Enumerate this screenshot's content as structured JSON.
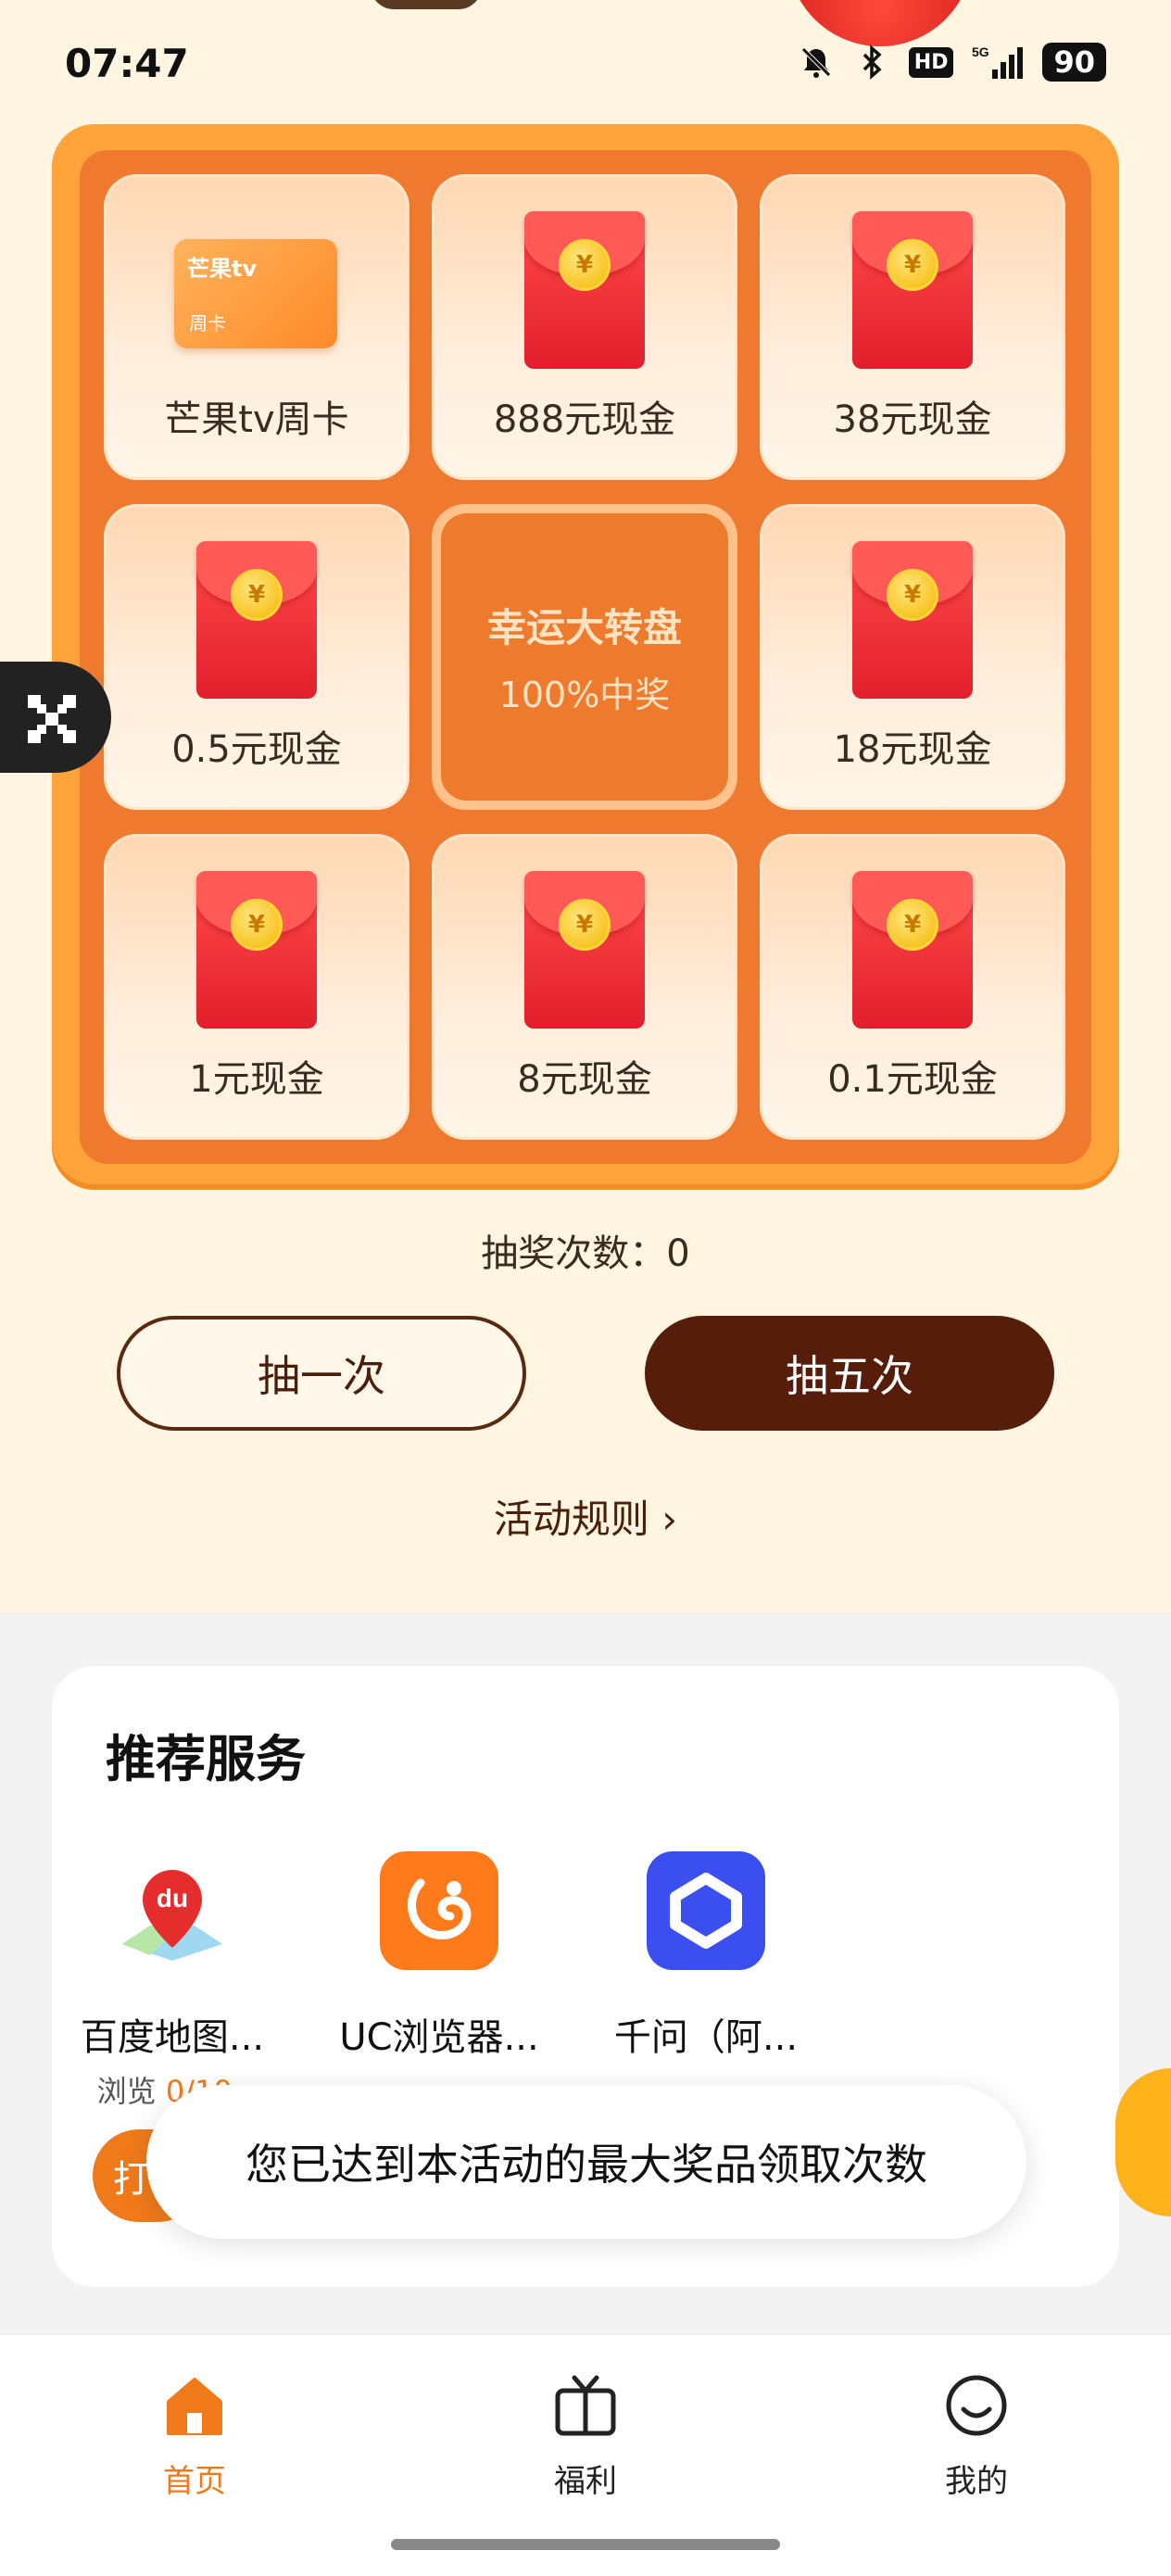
{
  "status_bar": {
    "time": "07:47",
    "hd": "HD",
    "network": "5G",
    "battery": "90"
  },
  "board": {
    "center": {
      "title": "幸运大转盘",
      "subtitle": "100%中奖"
    },
    "prizes": [
      {
        "label": "芒果tv周卡",
        "icon": "mango-tv-card"
      },
      {
        "label": "888元现金",
        "icon": "red-envelope"
      },
      {
        "label": "38元现金",
        "icon": "red-envelope"
      },
      {
        "label": "0.5元现金",
        "icon": "red-envelope"
      },
      {
        "label": "18元现金",
        "icon": "red-envelope"
      },
      {
        "label": "1元现金",
        "icon": "red-envelope"
      },
      {
        "label": "8元现金",
        "icon": "red-envelope"
      },
      {
        "label": "0.1元现金",
        "icon": "red-envelope"
      }
    ],
    "mango_card": {
      "logo": "芒果tv",
      "sub": "周卡"
    },
    "coin_symbol": "¥"
  },
  "draw": {
    "count_label": "抽奖次数：0",
    "once_label": "抽一次",
    "five_label": "抽五次",
    "rules_label": "活动规则 ›"
  },
  "services": {
    "title": "推荐服务",
    "apps": [
      {
        "name": "百度地图...",
        "progress_label": "浏览",
        "progress_value": "0/10s",
        "icon": "baidu-map-icon"
      },
      {
        "name": "UC浏览器...",
        "icon": "uc-browser-icon"
      },
      {
        "name": "千问（阿...",
        "icon": "qianwen-icon"
      }
    ],
    "pill_label": "打"
  },
  "toast": {
    "message": "您已达到本活动的最大奖品领取次数"
  },
  "nav": {
    "items": [
      {
        "label": "首页",
        "icon": "home-icon",
        "active": true
      },
      {
        "label": "福利",
        "icon": "tv-icon",
        "active": false
      },
      {
        "label": "我的",
        "icon": "smiley-icon",
        "active": false
      }
    ]
  },
  "colors": {
    "accent": "#f07a1a",
    "board_outer": "#ffa33a",
    "board_inner": "#ef7a2f",
    "primary_button": "#561e0a",
    "background": "#fff5e0"
  }
}
